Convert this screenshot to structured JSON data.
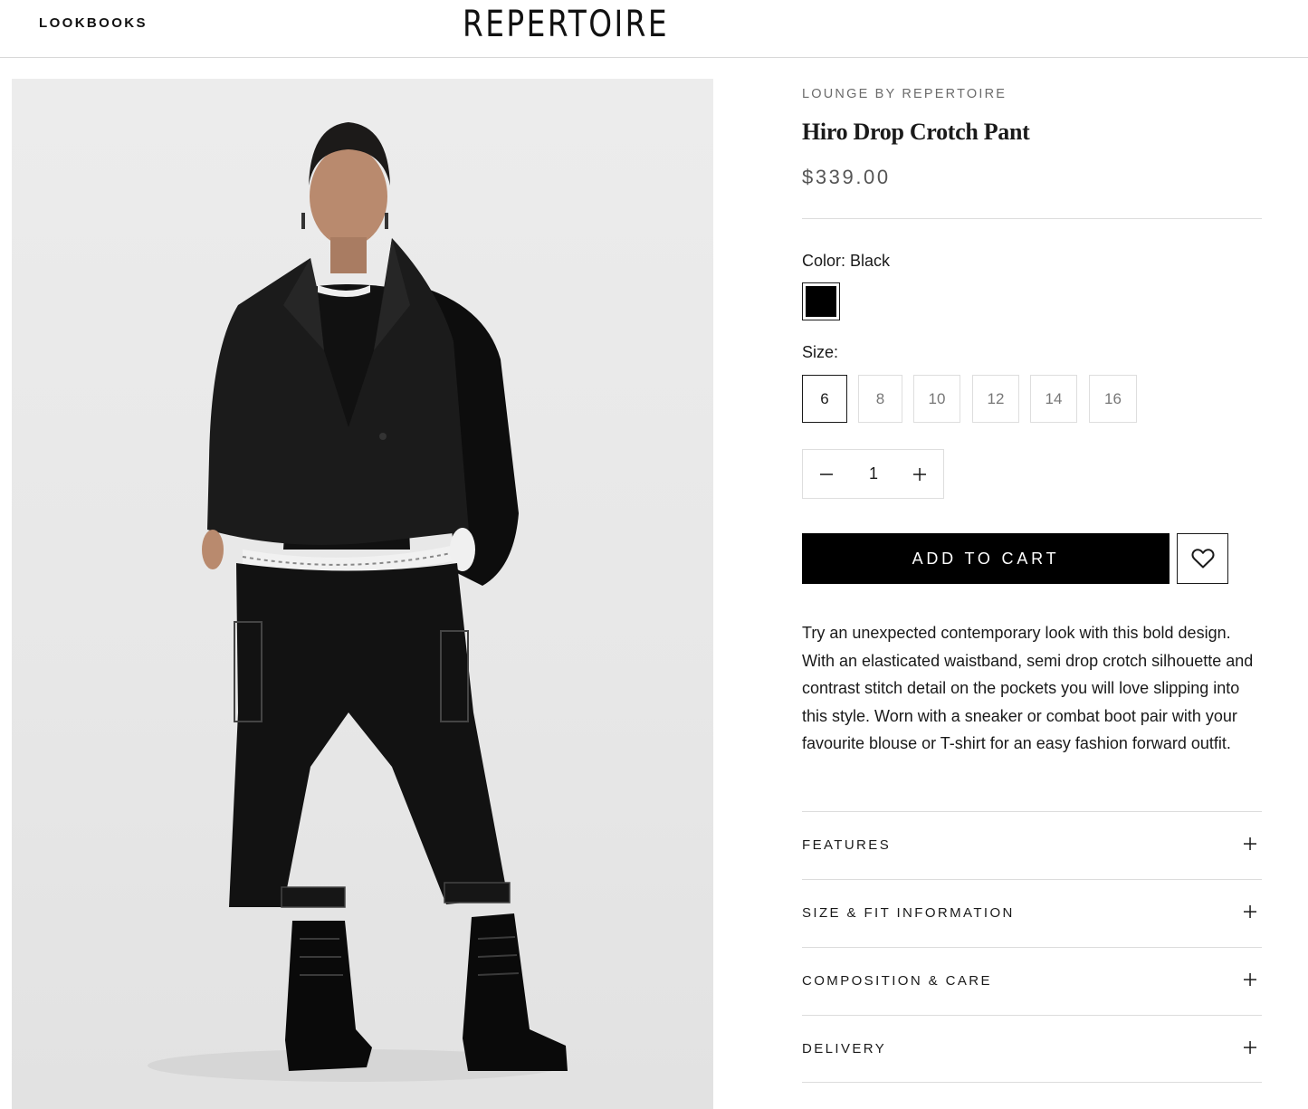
{
  "header": {
    "nav_link": "LOOKBOOKS",
    "logo": "REPERTOIRE"
  },
  "product": {
    "vendor": "LOUNGE BY REPERTOIRE",
    "title": "Hiro Drop Crotch Pant",
    "price": "$339.00",
    "color_label": "Color: Black",
    "color_swatch": "#000000",
    "size_label": "Size:",
    "sizes": [
      "6",
      "8",
      "10",
      "12",
      "14",
      "16"
    ],
    "selected_size": "6",
    "quantity": "1",
    "add_to_cart": "ADD TO CART",
    "description": "Try an unexpected contemporary look with this bold design. With an elasticated waistband, semi drop crotch silhouette and contrast stitch detail on the pockets you will love slipping into this style. Worn with a sneaker or combat boot pair with your favourite blouse or T-shirt for an easy fashion forward outfit."
  },
  "accordion": [
    {
      "label": "FEATURES"
    },
    {
      "label": "SIZE & FIT INFORMATION"
    },
    {
      "label": "COMPOSITION & CARE"
    },
    {
      "label": "DELIVERY"
    }
  ],
  "icons": {
    "minus": "minus-icon",
    "plus": "plus-icon",
    "wishlist": "heart-icon"
  }
}
